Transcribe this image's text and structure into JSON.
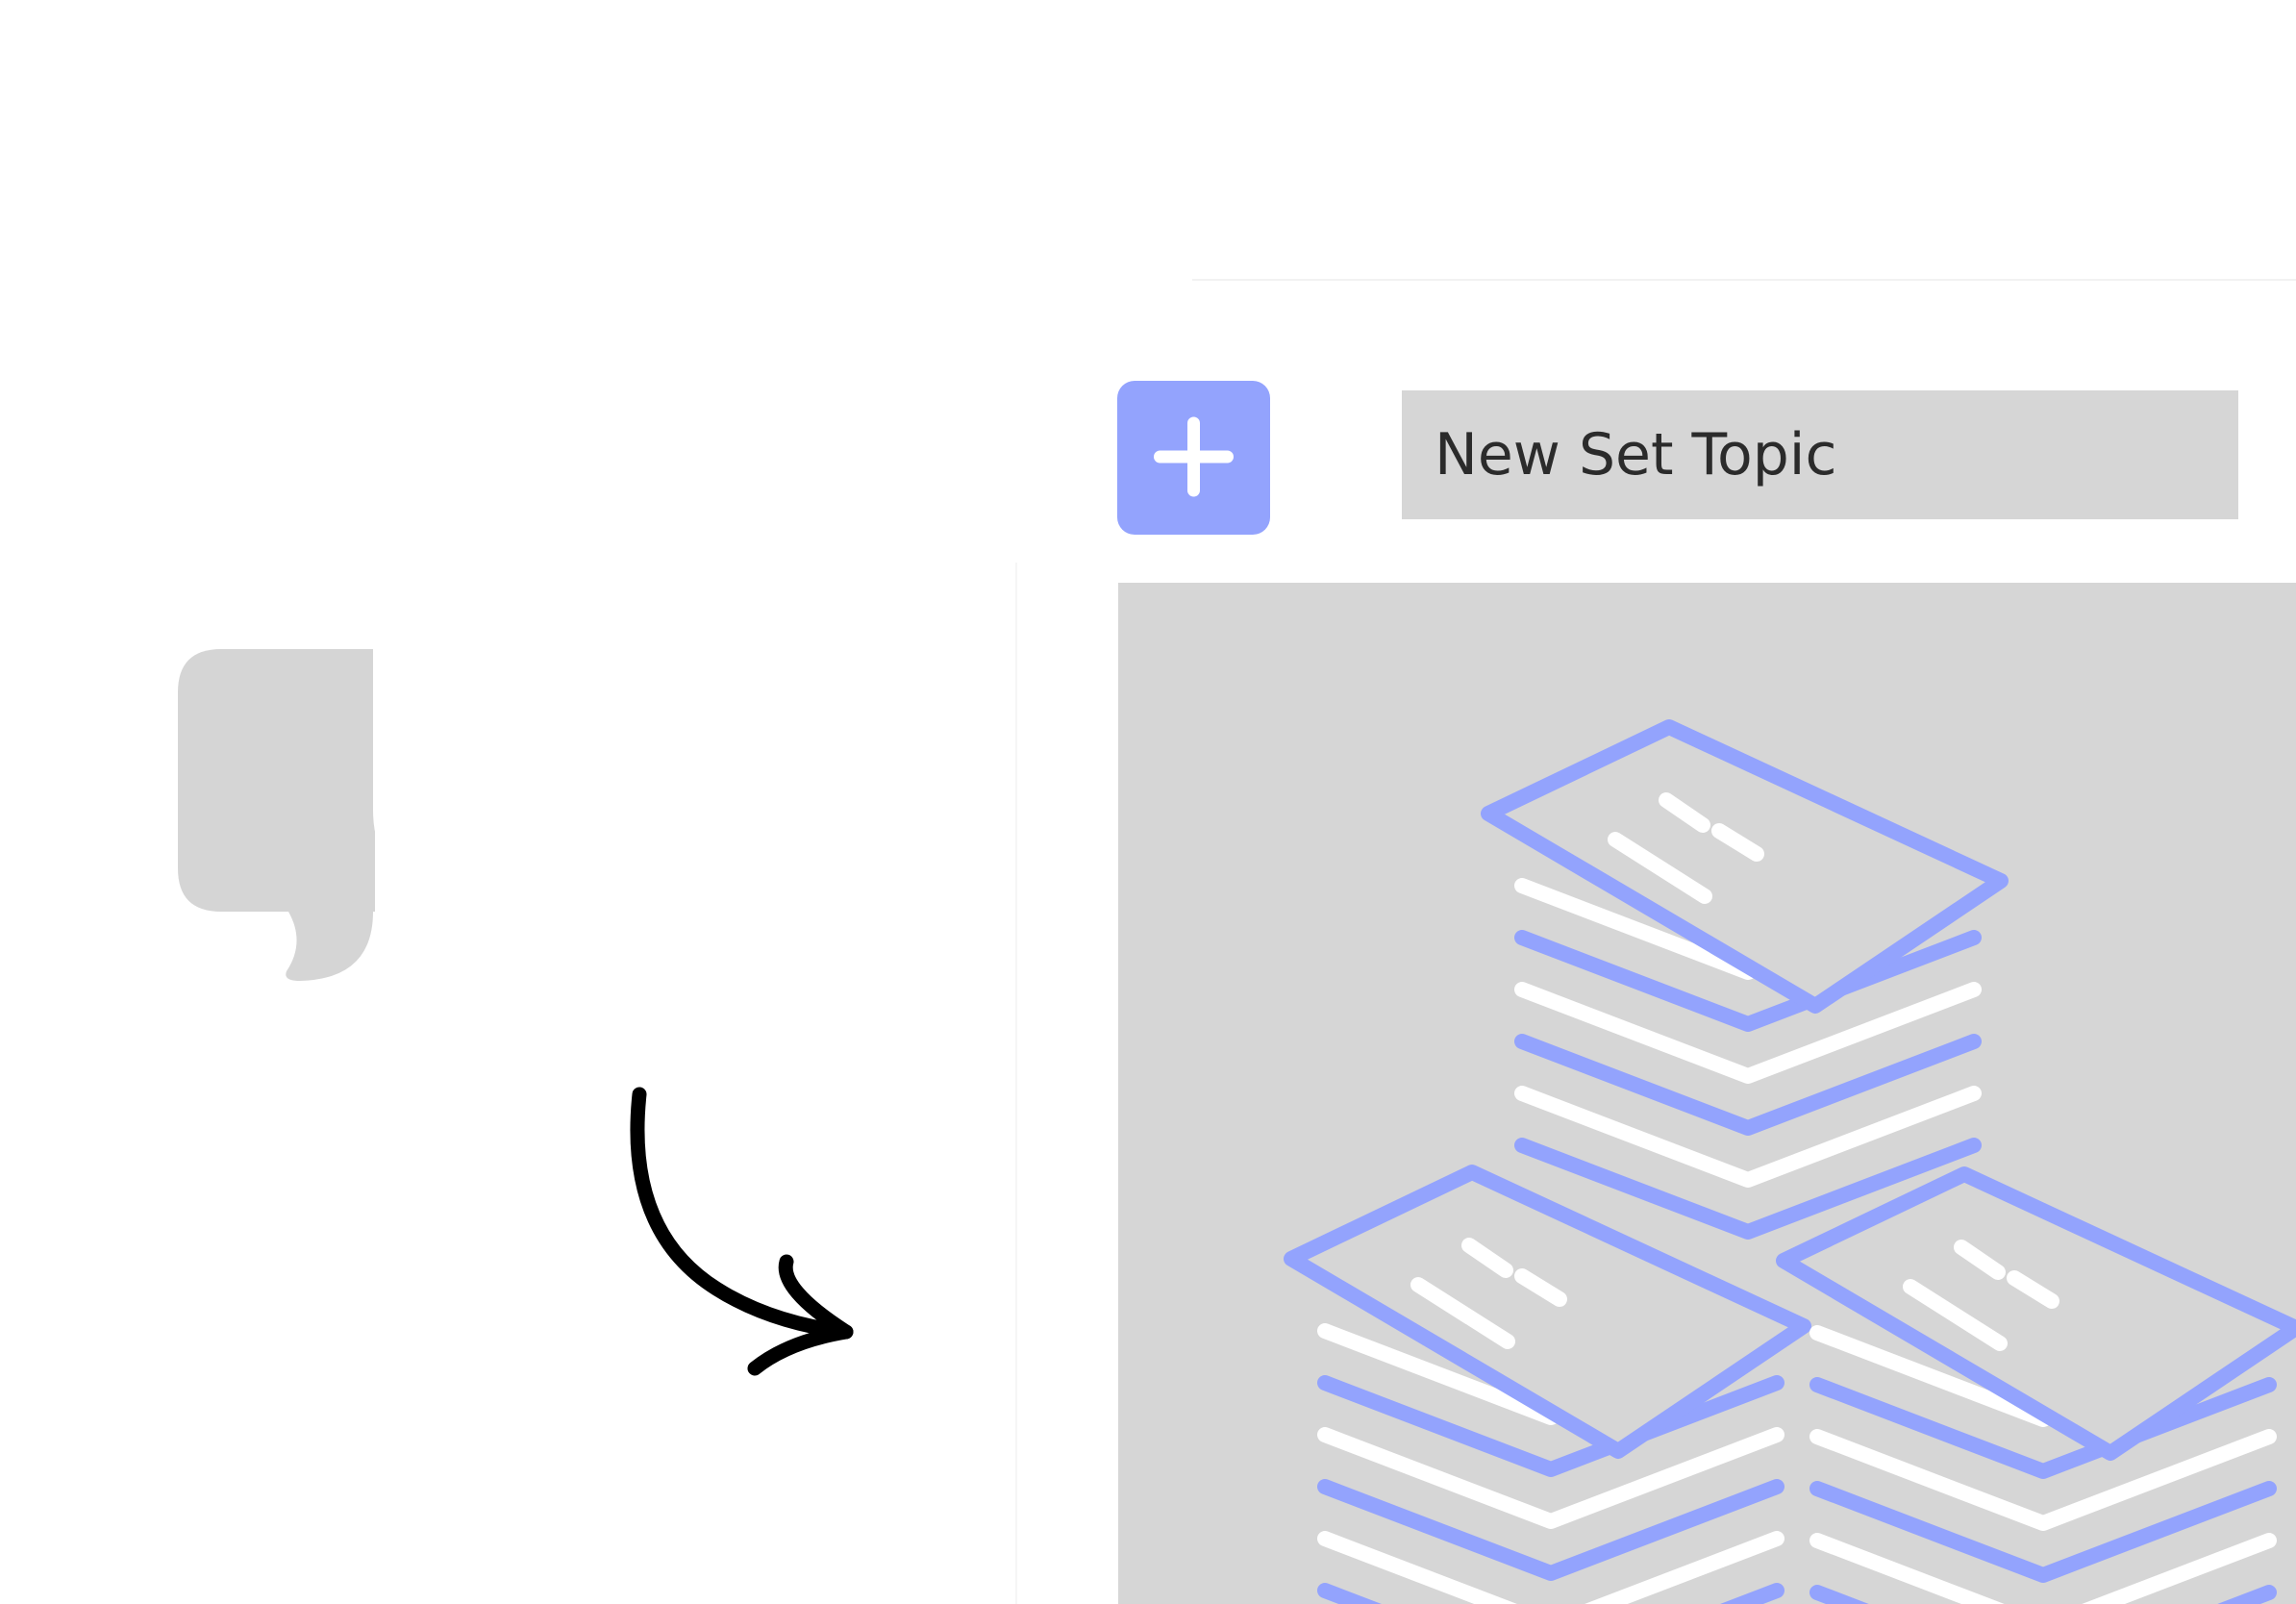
{
  "new_set": {
    "topic_input": {
      "value": "New Set Topic",
      "placeholder": ""
    },
    "add_button": {
      "icon": "plus-icon"
    }
  },
  "illustration": {
    "icon": "card-stacks-illustration"
  },
  "hint": {
    "chat_icon": "chat-bubble-icon",
    "arrow_icon": "curved-arrow-icon"
  },
  "colors": {
    "accent": "#93a3fd",
    "panel_gray": "#d6d6d6",
    "icon_gray": "#d5d5d5",
    "text": "#2b2b2b",
    "arrow": "#000000",
    "white": "#ffffff"
  }
}
